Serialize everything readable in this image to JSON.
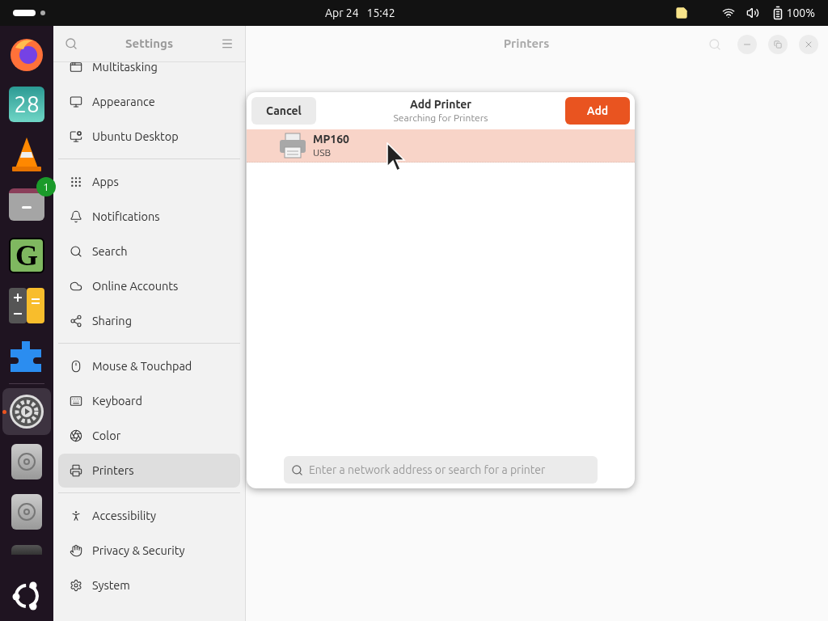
{
  "top_bar": {
    "date": "Apr 24",
    "time": "15:42",
    "battery": "100%"
  },
  "dock": [
    {
      "kind": "firefox",
      "running": false
    },
    {
      "kind": "calendar",
      "label": "28",
      "running": false
    },
    {
      "kind": "vlc",
      "running": false
    },
    {
      "kind": "files",
      "badge": "1",
      "running": false
    },
    {
      "kind": "letter",
      "label": "G",
      "running": false
    },
    {
      "kind": "calculator",
      "running": false
    },
    {
      "kind": "puzzle",
      "running": false
    },
    {
      "kind": "separator"
    },
    {
      "kind": "settings",
      "running": true,
      "selected": true
    },
    {
      "kind": "disc",
      "running": false
    },
    {
      "kind": "disc",
      "running": false
    },
    {
      "kind": "partial"
    },
    {
      "kind": "ubuntu",
      "running": false
    }
  ],
  "sidebar": {
    "title": "Settings",
    "groups": [
      [
        {
          "label": "Multitasking",
          "selected": false
        },
        {
          "label": "Appearance",
          "selected": false
        },
        {
          "label": "Ubuntu Desktop",
          "selected": false
        }
      ],
      [
        {
          "label": "Apps",
          "selected": false
        },
        {
          "label": "Notifications",
          "selected": false
        },
        {
          "label": "Search",
          "selected": false
        },
        {
          "label": "Online Accounts",
          "selected": false
        },
        {
          "label": "Sharing",
          "selected": false
        }
      ],
      [
        {
          "label": "Mouse & Touchpad",
          "selected": false
        },
        {
          "label": "Keyboard",
          "selected": false
        },
        {
          "label": "Color",
          "selected": false
        },
        {
          "label": "Printers",
          "selected": true
        }
      ],
      [
        {
          "label": "Accessibility",
          "selected": false
        },
        {
          "label": "Privacy & Security",
          "selected": false
        },
        {
          "label": "System",
          "selected": false
        }
      ]
    ]
  },
  "main": {
    "title": "Printers"
  },
  "dialog": {
    "title": "Add Printer",
    "subtitle": "Searching for Printers",
    "cancel": "Cancel",
    "confirm": "Add",
    "printers": [
      {
        "name": "MP160",
        "connection": "USB",
        "selected": true
      }
    ],
    "search": {
      "placeholder": "Enter a network address or search for a printer"
    }
  }
}
